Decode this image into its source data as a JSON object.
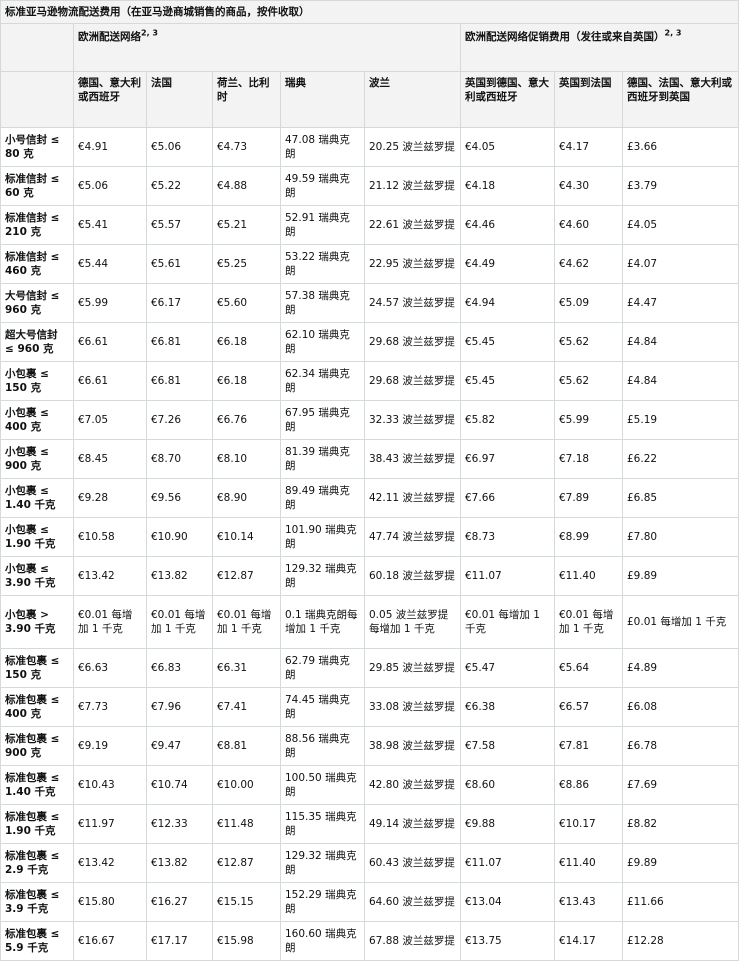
{
  "table": {
    "title": "标准亚马逊物流配送费用（在亚马逊商城销售的商品，按件收取）",
    "group_efn": "欧洲配送网络",
    "group_efn_sup": "2, 3",
    "group_promo": "欧洲配送网络促销费用（发往或来自英国）",
    "group_promo_sup": "2, 3",
    "columns": [
      "德国、意大利或西班牙",
      "法国",
      "荷兰、比利时",
      "瑞典",
      "波兰",
      "英国到德国、意大利或西班牙",
      "英国到法国",
      "德国、法国、意大利或西班牙到英国"
    ],
    "rows": [
      {
        "label": "小号信封 ≤ 80 克",
        "values": [
          "€4.91",
          "€5.06",
          "€4.73",
          "47.08 瑞典克朗",
          "20.25 波兰兹罗提",
          "€4.05",
          "€4.17",
          "£3.66"
        ]
      },
      {
        "label": "标准信封 ≤ 60 克",
        "values": [
          "€5.06",
          "€5.22",
          "€4.88",
          "49.59 瑞典克朗",
          "21.12 波兰兹罗提",
          "€4.18",
          "€4.30",
          "£3.79"
        ]
      },
      {
        "label": "标准信封 ≤ 210 克",
        "values": [
          "€5.41",
          "€5.57",
          "€5.21",
          "52.91 瑞典克朗",
          "22.61 波兰兹罗提",
          "€4.46",
          "€4.60",
          "£4.05"
        ]
      },
      {
        "label": "标准信封 ≤ 460 克",
        "values": [
          "€5.44",
          "€5.61",
          "€5.25",
          "53.22 瑞典克朗",
          "22.95 波兰兹罗提",
          "€4.49",
          "€4.62",
          "£4.07"
        ]
      },
      {
        "label": "大号信封 ≤ 960 克",
        "values": [
          "€5.99",
          "€6.17",
          "€5.60",
          "57.38 瑞典克朗",
          "24.57 波兰兹罗提",
          "€4.94",
          "€5.09",
          "£4.47"
        ]
      },
      {
        "label": "超大号信封 ≤ 960 克",
        "values": [
          "€6.61",
          "€6.81",
          "€6.18",
          "62.10 瑞典克朗",
          "29.68 波兰兹罗提",
          "€5.45",
          "€5.62",
          "£4.84"
        ]
      },
      {
        "label": "小包裹 ≤ 150 克",
        "values": [
          "€6.61",
          "€6.81",
          "€6.18",
          "62.34 瑞典克朗",
          "29.68 波兰兹罗提",
          "€5.45",
          "€5.62",
          "£4.84"
        ]
      },
      {
        "label": "小包裹 ≤ 400 克",
        "values": [
          "€7.05",
          "€7.26",
          "€6.76",
          "67.95 瑞典克朗",
          "32.33 波兰兹罗提",
          "€5.82",
          "€5.99",
          "£5.19"
        ]
      },
      {
        "label": "小包裹 ≤ 900 克",
        "values": [
          "€8.45",
          "€8.70",
          "€8.10",
          "81.39 瑞典克朗",
          "38.43 波兰兹罗提",
          "€6.97",
          "€7.18",
          "£6.22"
        ]
      },
      {
        "label": "小包裹 ≤ 1.40 千克",
        "values": [
          "€9.28",
          "€9.56",
          "€8.90",
          "89.49 瑞典克朗",
          "42.11 波兰兹罗提",
          "€7.66",
          "€7.89",
          "£6.85"
        ]
      },
      {
        "label": "小包裹 ≤ 1.90 千克",
        "values": [
          "€10.58",
          "€10.90",
          "€10.14",
          "101.90 瑞典克朗",
          "47.74 波兰兹罗提",
          "€8.73",
          "€8.99",
          "£7.80"
        ]
      },
      {
        "label": "小包裹 ≤ 3.90 千克",
        "values": [
          "€13.42",
          "€13.82",
          "€12.87",
          "129.32 瑞典克朗",
          "60.18 波兰兹罗提",
          "€11.07",
          "€11.40",
          "£9.89"
        ]
      },
      {
        "label": "小包裹 > 3.90 千克",
        "values": [
          "€0.01 每增加 1 千克",
          "€0.01 每增加 1 千克",
          "€0.01 每增加 1 千克",
          "0.1 瑞典克朗每增加 1 千克",
          "0.05 波兰兹罗提每增加 1 千克",
          "€0.01 每增加 1 千克",
          "€0.01 每增加 1 千克",
          "£0.01 每增加 1 千克"
        ]
      },
      {
        "label": "标准包裹 ≤ 150 克",
        "values": [
          "€6.63",
          "€6.83",
          "€6.31",
          "62.79 瑞典克朗",
          "29.85 波兰兹罗提",
          "€5.47",
          "€5.64",
          "£4.89"
        ]
      },
      {
        "label": "标准包裹 ≤ 400 克",
        "values": [
          "€7.73",
          "€7.96",
          "€7.41",
          "74.45 瑞典克朗",
          "33.08 波兰兹罗提",
          "€6.38",
          "€6.57",
          "£6.08"
        ]
      },
      {
        "label": "标准包裹 ≤ 900 克",
        "values": [
          "€9.19",
          "€9.47",
          "€8.81",
          "88.56 瑞典克朗",
          "38.98 波兰兹罗提",
          "€7.58",
          "€7.81",
          "£6.78"
        ]
      },
      {
        "label": "标准包裹 ≤ 1.40 千克",
        "values": [
          "€10.43",
          "€10.74",
          "€10.00",
          "100.50 瑞典克朗",
          "42.80 波兰兹罗提",
          "€8.60",
          "€8.86",
          "£7.69"
        ]
      },
      {
        "label": "标准包裹 ≤ 1.90 千克",
        "values": [
          "€11.97",
          "€12.33",
          "€11.48",
          "115.35 瑞典克朗",
          "49.14 波兰兹罗提",
          "€9.88",
          "€10.17",
          "£8.82"
        ]
      },
      {
        "label": "标准包裹 ≤ 2.9 千克",
        "values": [
          "€13.42",
          "€13.82",
          "€12.87",
          "129.32 瑞典克朗",
          "60.43 波兰兹罗提",
          "€11.07",
          "€11.40",
          "£9.89"
        ]
      },
      {
        "label": "标准包裹 ≤ 3.9 千克",
        "values": [
          "€15.80",
          "€16.27",
          "€15.15",
          "152.29 瑞典克朗",
          "64.60 波兰兹罗提",
          "€13.04",
          "€13.43",
          "£11.66"
        ]
      },
      {
        "label": "标准包裹 ≤ 5.9 千克",
        "values": [
          "€16.67",
          "€17.17",
          "€15.98",
          "160.60 瑞典克朗",
          "67.88 波兰兹罗提",
          "€13.75",
          "€14.17",
          "£12.28"
        ]
      }
    ]
  }
}
